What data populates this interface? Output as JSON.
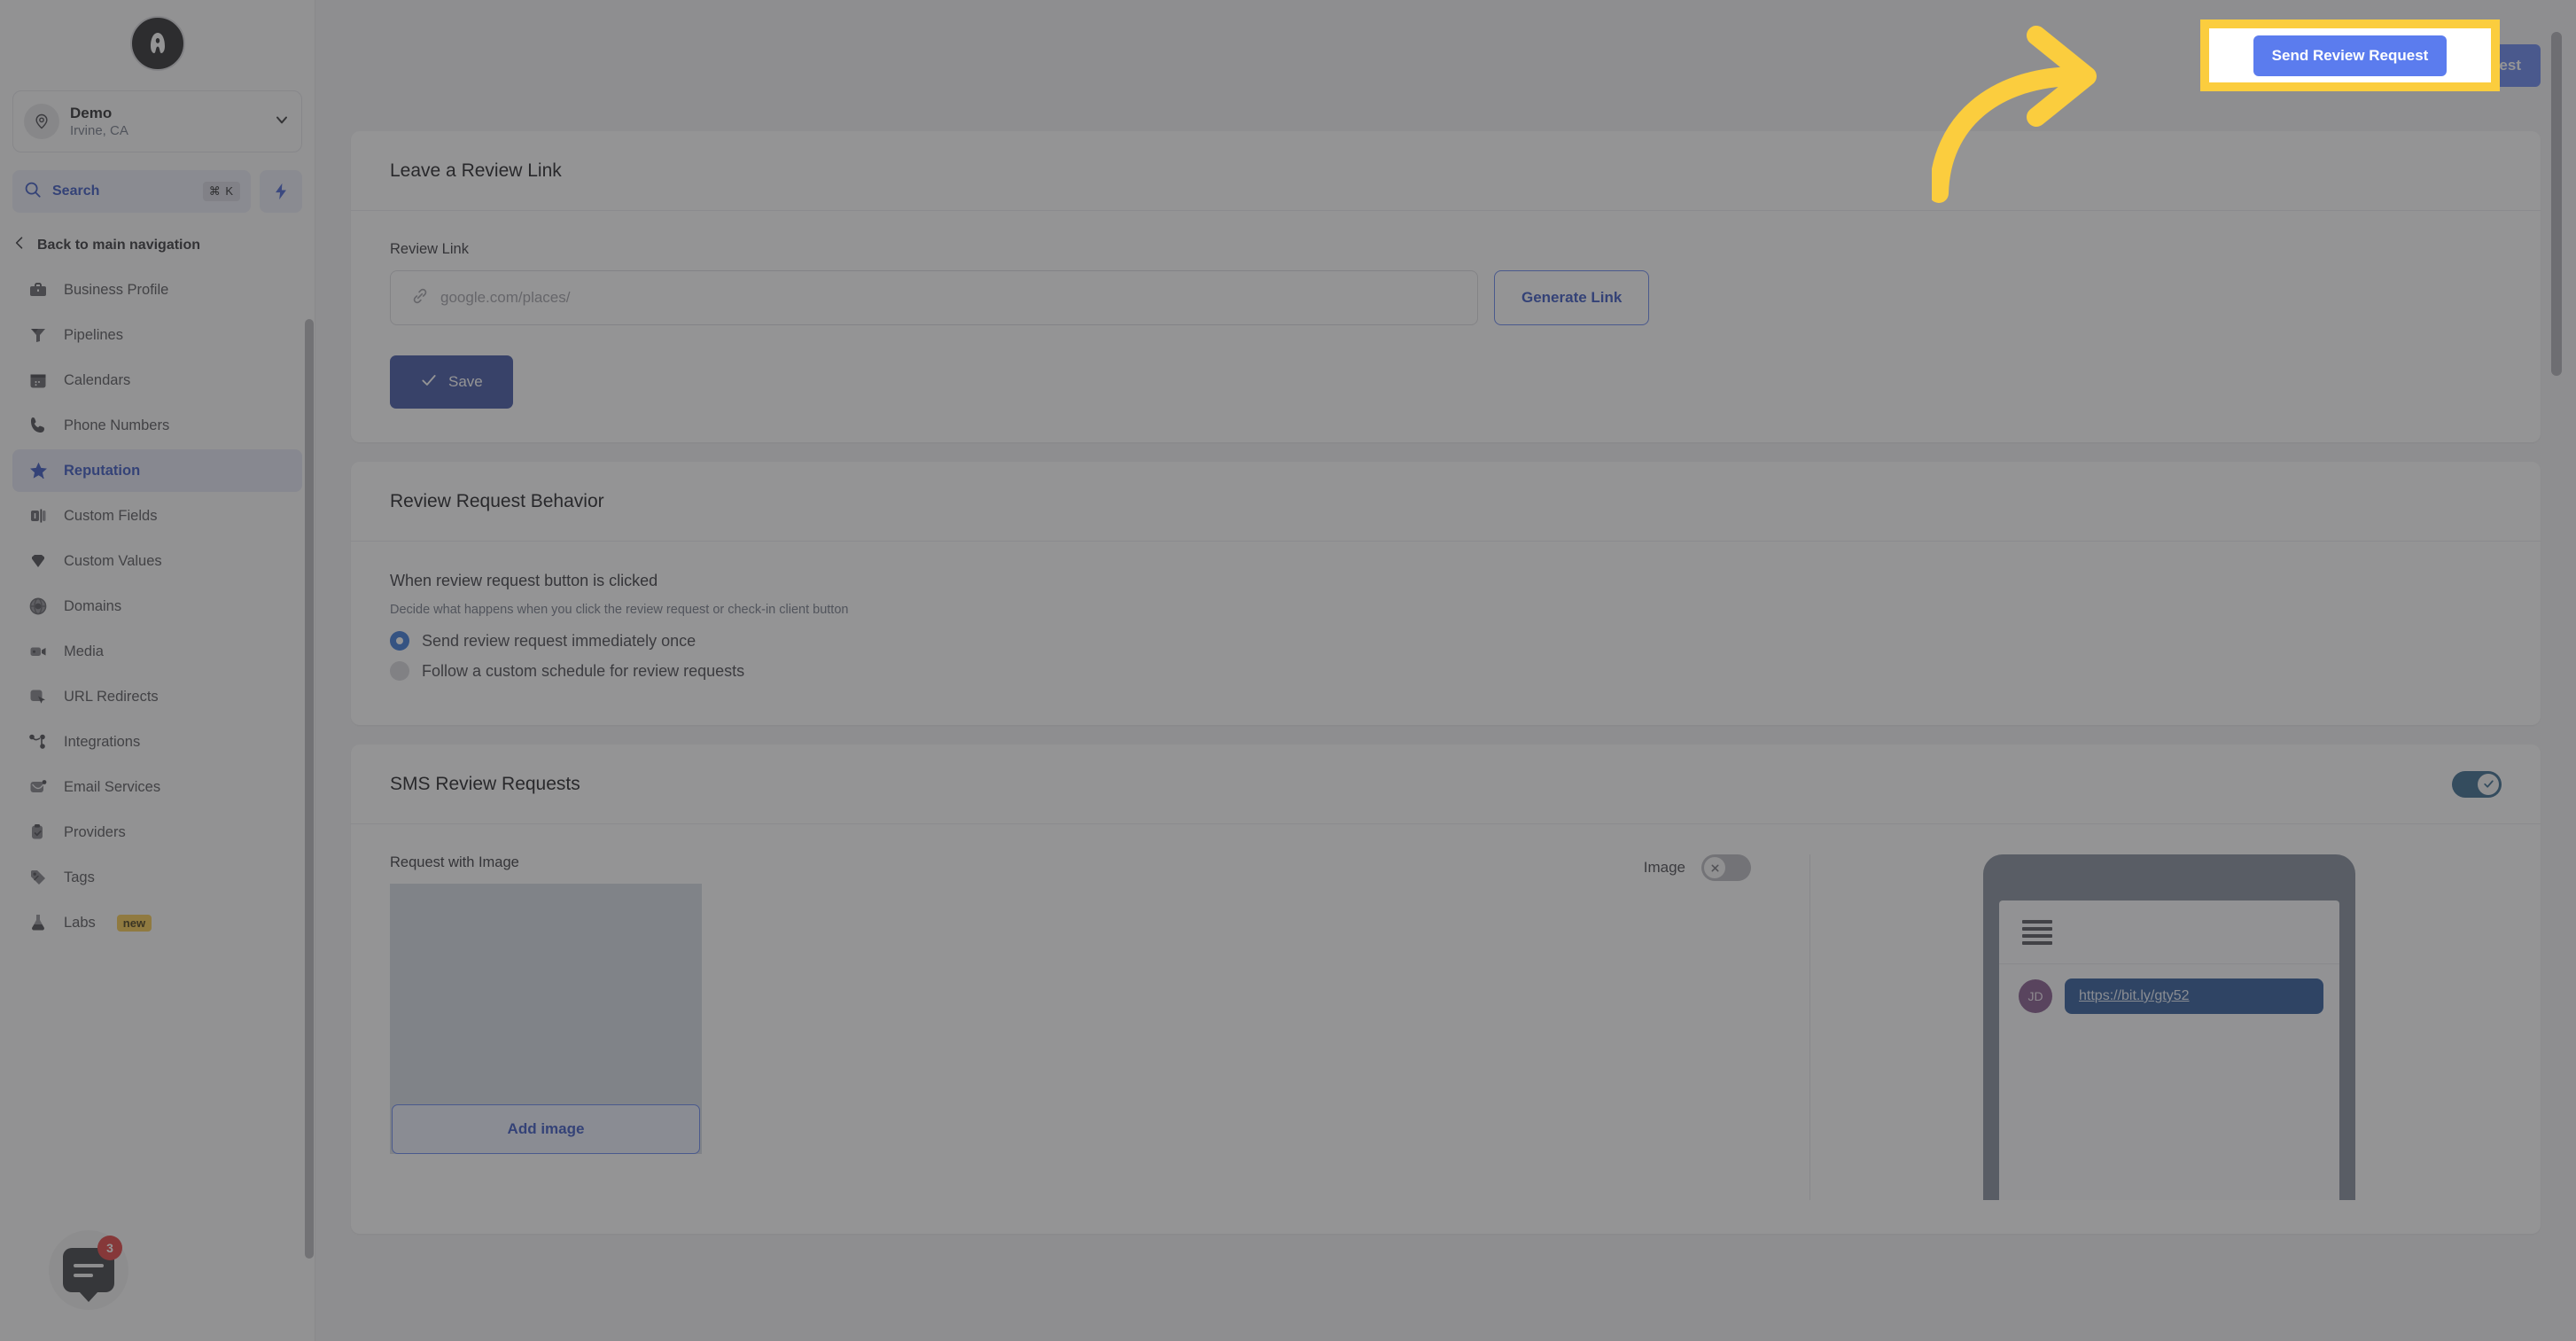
{
  "sidebar": {
    "logo_icon": "brand-a-logo",
    "location": {
      "icon": "map-pin-icon",
      "name": "Demo",
      "sub": "Irvine, CA",
      "chevron_icon": "chevron-down-icon"
    },
    "search": {
      "icon": "search-icon",
      "label": "Search",
      "shortcut": "⌘ K",
      "bolt_icon": "bolt-icon"
    },
    "back": {
      "icon": "chevron-left-icon",
      "label": "Back to main navigation"
    },
    "items": [
      {
        "label": "Business Profile",
        "icon": "briefcase-icon",
        "active": false
      },
      {
        "label": "Pipelines",
        "icon": "funnel-icon",
        "active": false
      },
      {
        "label": "Calendars",
        "icon": "calendar-icon",
        "active": false
      },
      {
        "label": "Phone Numbers",
        "icon": "phone-icon",
        "active": false
      },
      {
        "label": "Reputation",
        "icon": "star-icon",
        "active": true
      },
      {
        "label": "Custom Fields",
        "icon": "custom-fields-icon",
        "active": false
      },
      {
        "label": "Custom Values",
        "icon": "gem-icon",
        "active": false
      },
      {
        "label": "Domains",
        "icon": "globe-icon",
        "active": false
      },
      {
        "label": "Media",
        "icon": "video-icon",
        "active": false
      },
      {
        "label": "URL Redirects",
        "icon": "cursor-click-icon",
        "active": false
      },
      {
        "label": "Integrations",
        "icon": "share-nodes-icon",
        "active": false
      },
      {
        "label": "Email Services",
        "icon": "envelope-icon",
        "active": false
      },
      {
        "label": "Providers",
        "icon": "clipboard-check-icon",
        "active": false
      },
      {
        "label": "Tags",
        "icon": "tag-icon",
        "active": false
      },
      {
        "label": "Labs",
        "icon": "flask-icon",
        "active": false,
        "badge": "new"
      }
    ],
    "chat": {
      "icon": "chat-bubble-icon",
      "count": "3"
    }
  },
  "topbar": {
    "send_review_request_label": "Send Review Request"
  },
  "highlight": {
    "label": "Send Review Request",
    "border_color": "#fbcd3e",
    "arrow_icon": "curved-arrow-icon"
  },
  "review_link_card": {
    "title": "Leave a Review Link",
    "field_label": "Review Link",
    "link_icon": "link-icon",
    "input_value": "",
    "input_placeholder": "google.com/places/",
    "generate_label": "Generate Link",
    "save_label": "Save",
    "save_icon": "check-icon"
  },
  "behavior_card": {
    "title": "Review Request Behavior",
    "sub_head": "When review request button is clicked",
    "description": "Decide what happens when you click the review request or check-in client button",
    "options": [
      {
        "label": "Send review request immediately once",
        "selected": true
      },
      {
        "label": "Follow a custom schedule for review requests",
        "selected": false
      }
    ]
  },
  "sms_card": {
    "title": "SMS Review Requests",
    "enabled_toggle": {
      "state": "on",
      "icon": "check-icon"
    },
    "request_with_image_label": "Request with Image",
    "add_image_label": "Add image",
    "image_toggle_label": "Image",
    "image_toggle": {
      "state": "off",
      "icon": "x-icon"
    },
    "preview": {
      "hamburger_icon": "hamburger-menu-icon",
      "avatar_initials": "JD",
      "message_text": "https://bit.ly/gty52"
    }
  },
  "colors": {
    "accent_blue": "#5b7cee",
    "deep_blue": "#33499e",
    "highlight_yellow": "#fbcd3e",
    "toggle_on": "#2c5f86"
  }
}
